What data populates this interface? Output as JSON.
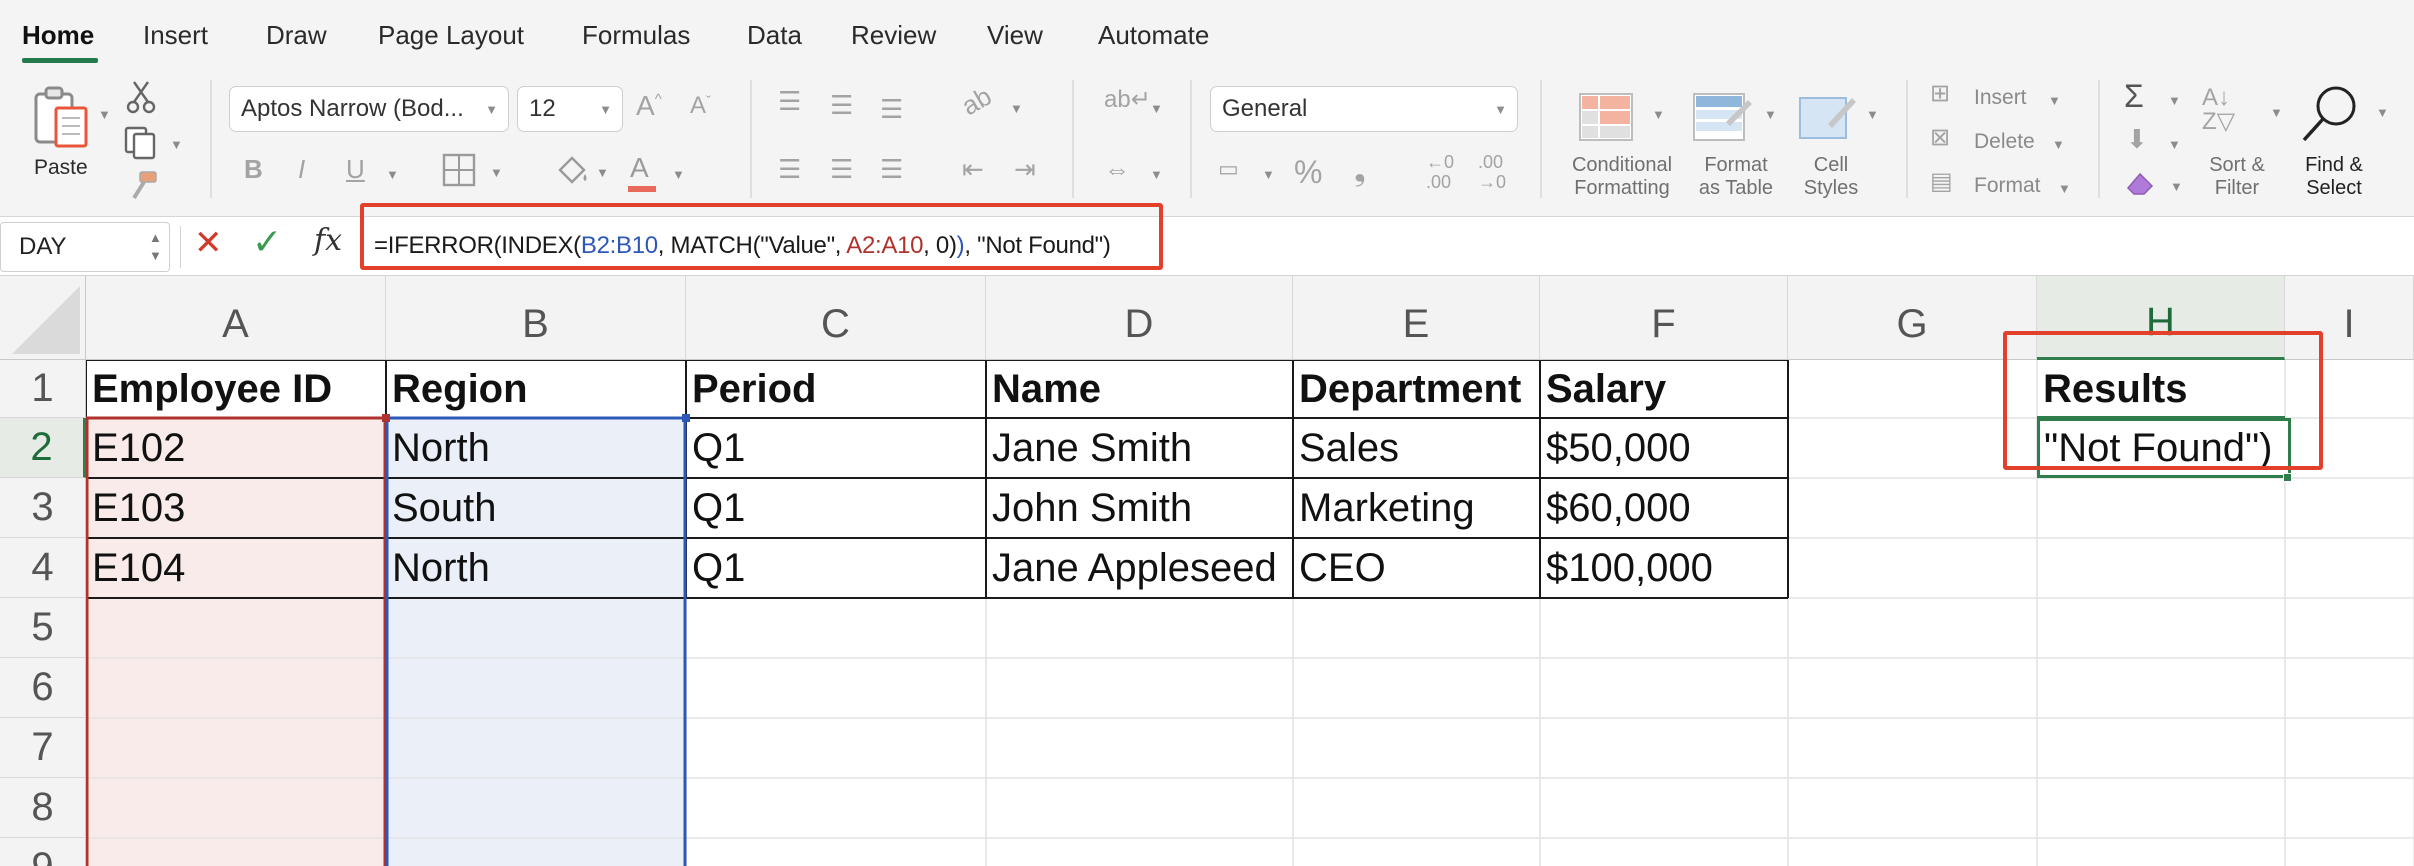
{
  "ribbon": {
    "tabs": [
      "Home",
      "Insert",
      "Draw",
      "Page Layout",
      "Formulas",
      "Data",
      "Review",
      "View",
      "Automate"
    ],
    "paste_label": "Paste",
    "font_name": "Aptos Narrow (Bod...",
    "font_size": "12",
    "number_format": "General",
    "comma_glyph": "❟",
    "styles": {
      "conditional": [
        "Conditional",
        "Formatting"
      ],
      "format_table": [
        "Format",
        "as Table"
      ],
      "cell_styles": [
        "Cell",
        "Styles"
      ]
    },
    "cells_group": {
      "insert": "Insert",
      "delete": "Delete",
      "format": "Format"
    },
    "editing": {
      "sort_filter": [
        "Sort &",
        "Filter"
      ],
      "find_select": [
        "Find &",
        "Select"
      ]
    }
  },
  "formula_bar": {
    "name_box": "DAY",
    "formula_parts": [
      {
        "text": "=IFERROR(INDEX(",
        "color": "#1a1a1a"
      },
      {
        "text": "B2:B10",
        "color": "#2d58b8"
      },
      {
        "text": ", MATCH(\"Value\", ",
        "color": "#1a1a1a"
      },
      {
        "text": "A2:A10",
        "color": "#b0322c"
      },
      {
        "text": ", 0)",
        "color": "#1a1a1a"
      },
      {
        "text": ")",
        "color": "#2d58b8"
      },
      {
        "text": ", \"Not Found\")",
        "color": "#1a1a1a"
      }
    ]
  },
  "sheet": {
    "columns": [
      "A",
      "B",
      "C",
      "D",
      "E",
      "F",
      "G",
      "H",
      "I"
    ],
    "rows": [
      "1",
      "2",
      "3",
      "4",
      "5",
      "6",
      "7",
      "8",
      "9"
    ],
    "headers": [
      "Employee ID",
      "Region",
      "Period",
      "Name",
      "Department",
      "Salary"
    ],
    "data": [
      [
        "E102",
        "North",
        "Q1",
        "Jane Smith",
        "Sales",
        "$50,000"
      ],
      [
        "E103",
        "South",
        "Q1",
        "John Smith",
        "Marketing",
        "$60,000"
      ],
      [
        "E104",
        "North",
        "Q1",
        "Jane Appleseed",
        "CEO",
        "$100,000"
      ]
    ],
    "results_header": "Results",
    "active_cell_text": "\"Not Found\")"
  },
  "colors": {
    "accent_green": "#237b4b",
    "callout_red": "#e3402b",
    "range_red": "#b0322c",
    "range_blue": "#2d58b8"
  }
}
